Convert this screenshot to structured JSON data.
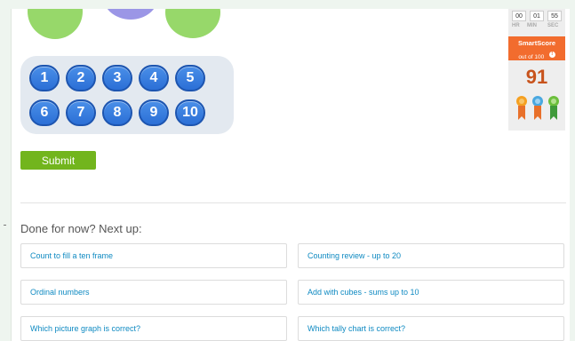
{
  "numpad": {
    "keys": [
      "1",
      "2",
      "3",
      "4",
      "5",
      "6",
      "7",
      "8",
      "9",
      "10"
    ]
  },
  "submit_label": "Submit",
  "next_up_heading": "Done for now? Next up:",
  "next_links": [
    "Count to fill a ten frame",
    "Counting review - up to 20",
    "Ordinal numbers",
    "Add with cubes - sums up to 10",
    "Which picture graph is correct?",
    "Which tally chart is correct?"
  ],
  "timer": {
    "hr": "00",
    "min": "01",
    "sec": "55",
    "hr_label": "HR",
    "min_label": "MIN",
    "sec_label": "SEC"
  },
  "smartscore": {
    "title": "SmartScore",
    "subtitle": "out of 100",
    "value": "91"
  },
  "colors": {
    "accent_green": "#72b51d",
    "key_blue": "#2b6fd6",
    "score_orange": "#f26c2e",
    "link_blue": "#0f8ac2"
  },
  "icons": [
    "info-icon",
    "ribbon-orange-icon",
    "ribbon-blue-icon",
    "ribbon-green-icon"
  ]
}
